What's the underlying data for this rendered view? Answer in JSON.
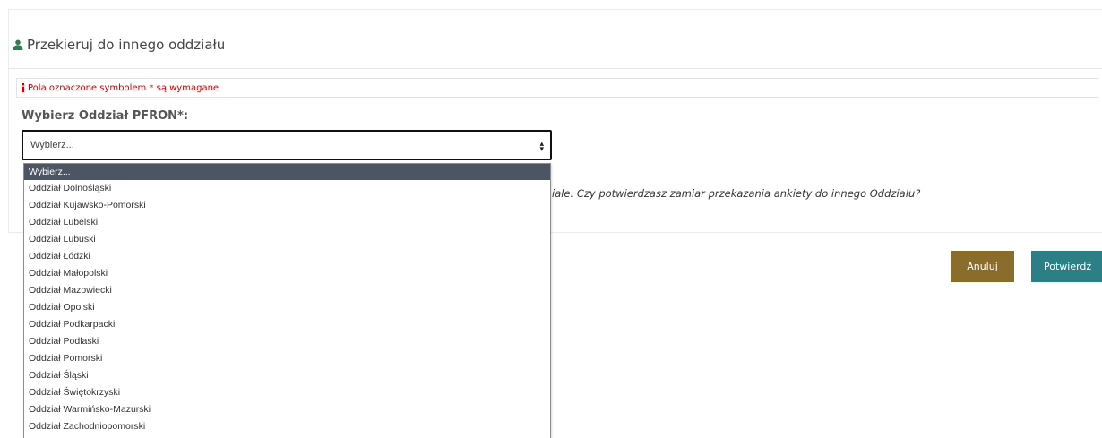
{
  "header": {
    "title": "Przekieruj do innego oddziału",
    "icon": "user-icon"
  },
  "notice": {
    "text": "Pola oznaczone symbolem * są wymagane.",
    "icon": "info-icon",
    "color": "#cc0000"
  },
  "field": {
    "label": "Wybierz Oddział PFRON*:",
    "value": "Wybierz...",
    "options": [
      "Wybierz...",
      "Oddział Dolnośląski",
      "Oddział Kujawsko-Pomorski",
      "Oddział Lubelski",
      "Oddział Lubuski",
      "Oddział Łódzki",
      "Oddział Małopolski",
      "Oddział Mazowiecki",
      "Oddział Opolski",
      "Oddział Podkarpacki",
      "Oddział Podlaski",
      "Oddział Pomorski",
      "Oddział Śląski",
      "Oddział Świętokrzyski",
      "Oddział Warmińsko-Mazurski",
      "Oddział Zachodniopomorski"
    ]
  },
  "confirmation": {
    "text": "iale. Czy potwierdzasz zamiar przekazania ankiety do innego Oddziału?"
  },
  "buttons": {
    "cancel": "Anuluj",
    "confirm": "Potwierdź",
    "cancel_color": "#8a6c2b",
    "confirm_color": "#2b7f85"
  }
}
